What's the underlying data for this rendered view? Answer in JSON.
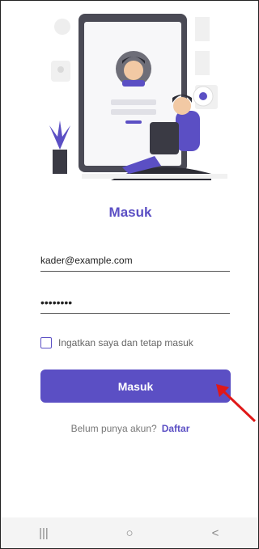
{
  "login": {
    "title": "Masuk",
    "email_value": "kader@example.com",
    "password_value": "••••••••",
    "remember_label": "Ingatkan saya dan tetap masuk",
    "submit_label": "Masuk",
    "signup_prompt": "Belum punya akun?",
    "signup_link": "Daftar"
  },
  "navbar": {
    "recent": "|||",
    "home": "○",
    "back": "<"
  },
  "colors": {
    "accent": "#5b4fc4",
    "arrow": "#e01818"
  }
}
